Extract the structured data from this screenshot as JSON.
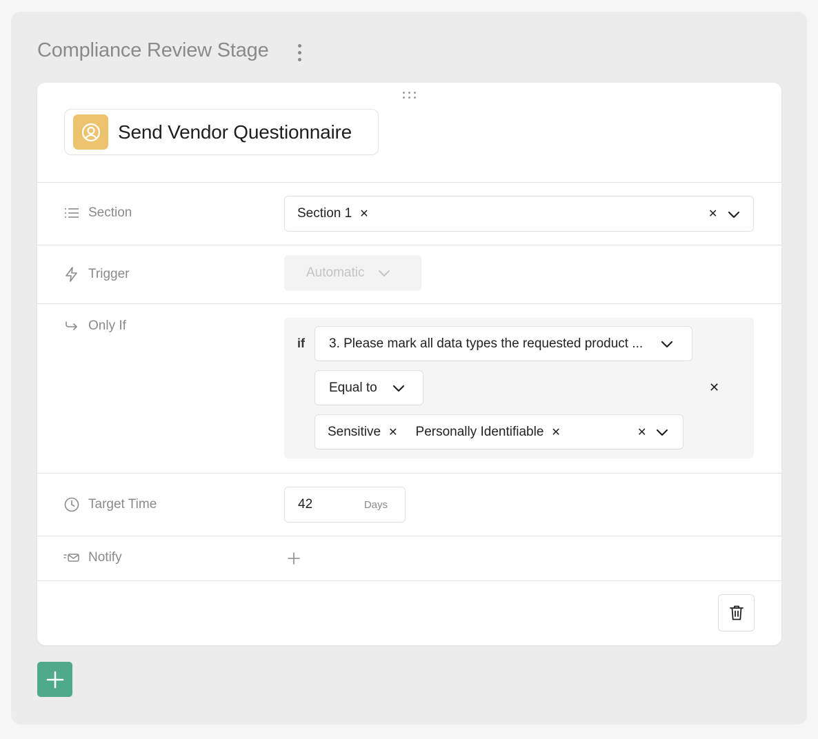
{
  "stage": {
    "title": "Compliance Review Stage"
  },
  "action": {
    "title": "Send Vendor Questionnaire"
  },
  "section": {
    "label": "Section",
    "selected": [
      {
        "text": "Section 1"
      }
    ]
  },
  "trigger": {
    "label": "Trigger",
    "value": "Automatic"
  },
  "only_if": {
    "label": "Only If",
    "if_label": "if",
    "question": "3. Please mark all data types the requested product ...",
    "operator": "Equal to",
    "values": [
      {
        "text": "Sensitive"
      },
      {
        "text": "Personally Identifiable"
      }
    ]
  },
  "target_time": {
    "label": "Target Time",
    "value": "42",
    "unit": "Days"
  },
  "notify": {
    "label": "Notify"
  },
  "colors": {
    "accent_green": "#4fa98a",
    "action_icon_bg": "#eec36e",
    "label_gray": "#8a8a8a"
  },
  "icons": {
    "stage_menu": "vertical-dots-icon",
    "drag": "drag-handle-icon",
    "action": "user-circle-icon",
    "section": "list-icon",
    "trigger": "lightning-icon",
    "only_if": "arrow-turn-right-icon",
    "target_time": "clock-icon",
    "notify": "mail-send-icon",
    "delete": "trash-icon",
    "add": "plus-icon"
  }
}
